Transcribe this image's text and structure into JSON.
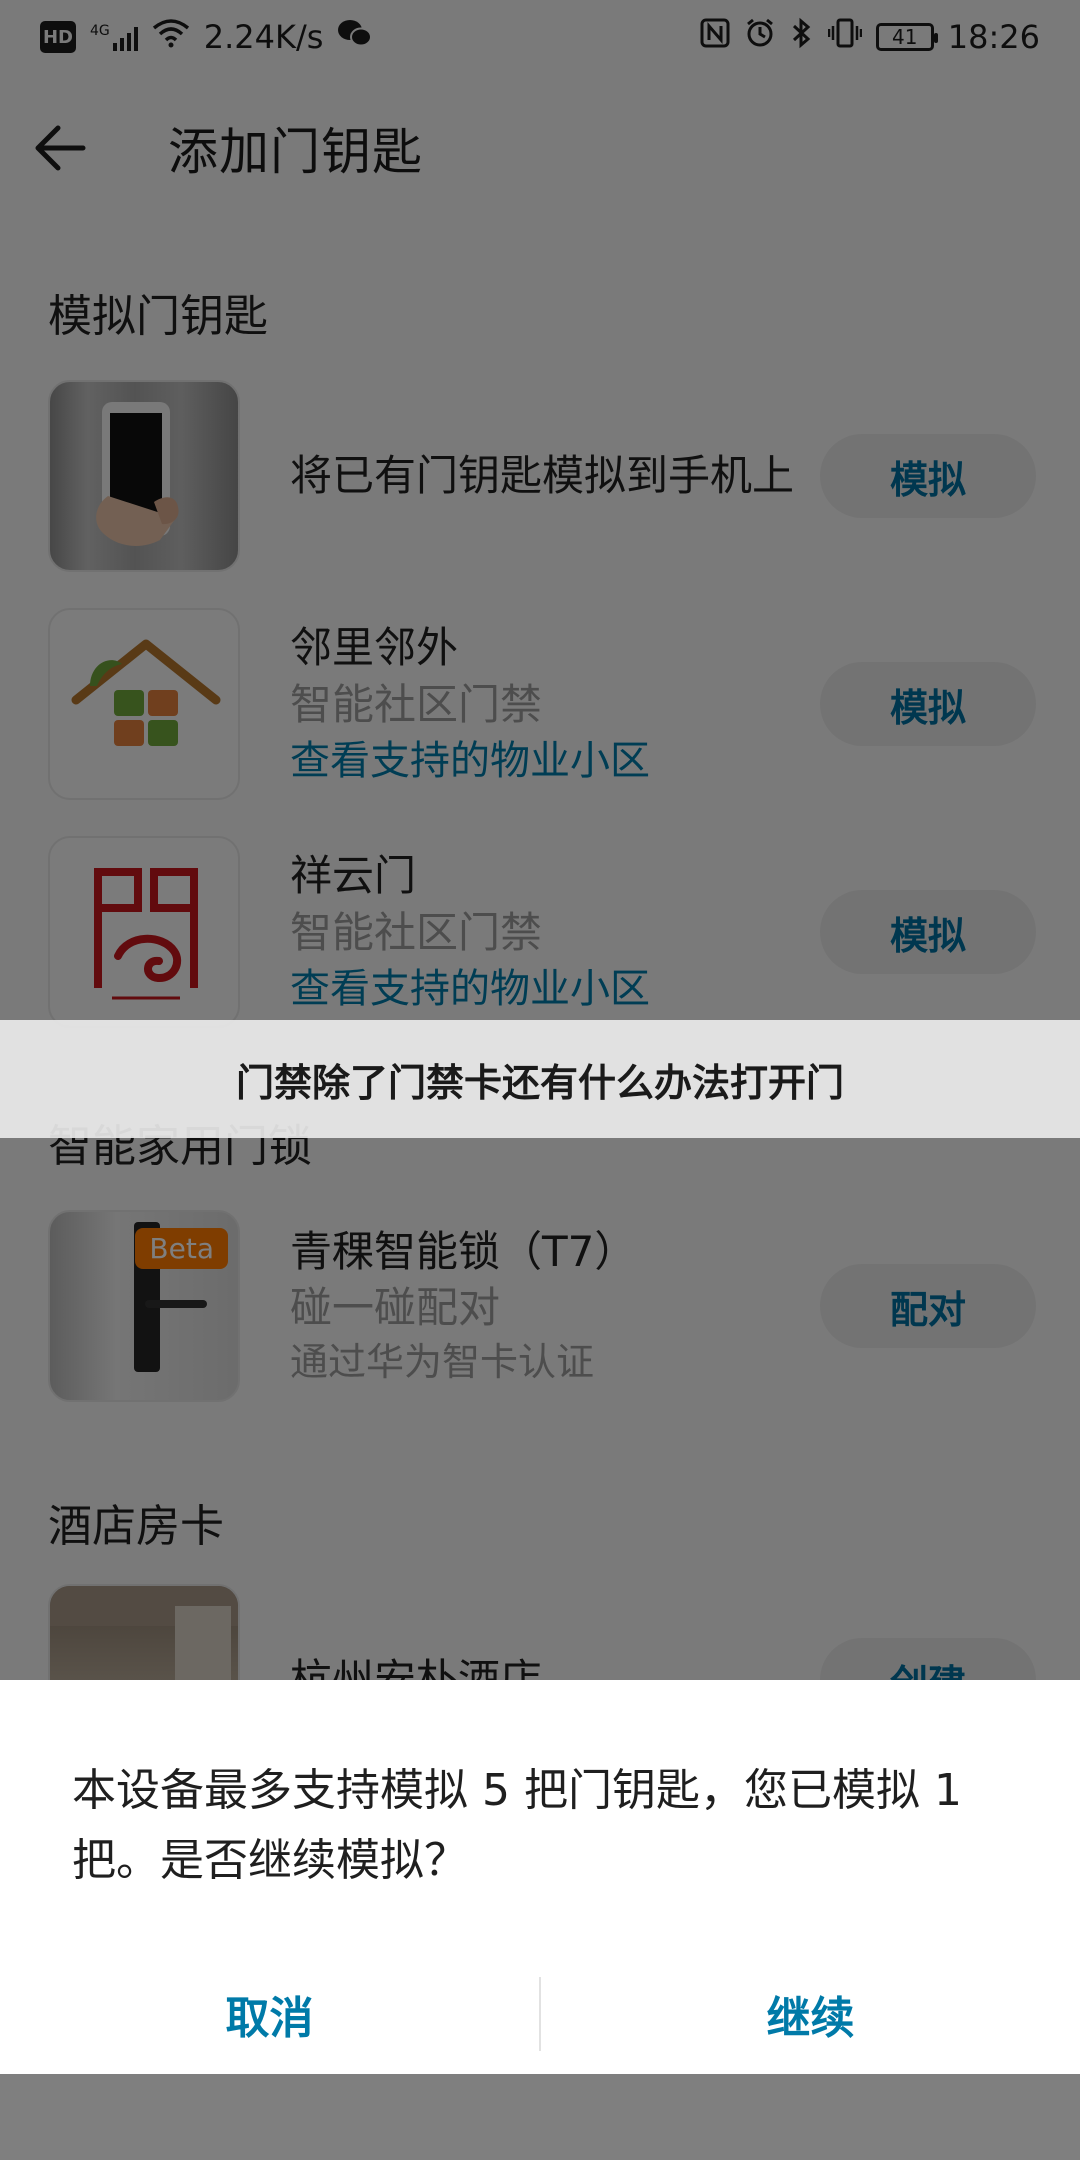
{
  "status_bar": {
    "network_label": "HD",
    "signal_label": "4G",
    "speed": "2.24K/s",
    "battery": "41",
    "time": "18:26"
  },
  "header": {
    "title": "添加门钥匙"
  },
  "sections": {
    "simulate": {
      "title": "模拟门钥匙",
      "items": [
        {
          "title": "将已有门钥匙模拟到手机上",
          "button": "模拟"
        },
        {
          "title": "邻里邻外",
          "subtitle": "智能社区门禁",
          "link": "查看支持的物业小区",
          "button": "模拟"
        },
        {
          "title": "祥云门",
          "subtitle": "智能社区门禁",
          "link": "查看支持的物业小区",
          "button": "模拟"
        }
      ]
    },
    "smart_lock": {
      "title": "智能家用门锁",
      "items": [
        {
          "title": "青稞智能锁（T7）",
          "subtitle": "碰一碰配对",
          "subtitle2": "通过华为智卡认证",
          "badge": "Beta",
          "button": "配对"
        }
      ]
    },
    "hotel": {
      "title": "酒店房卡",
      "items": [
        {
          "title": "杭州安朴酒店",
          "button": "创建"
        }
      ]
    }
  },
  "banner": {
    "text": "门禁除了门禁卡还有什么办法打开门"
  },
  "dialog": {
    "message": "本设备最多支持模拟 5 把门钥匙，您已模拟 1 把。是否继续模拟？",
    "cancel": "取消",
    "confirm": "继续"
  }
}
